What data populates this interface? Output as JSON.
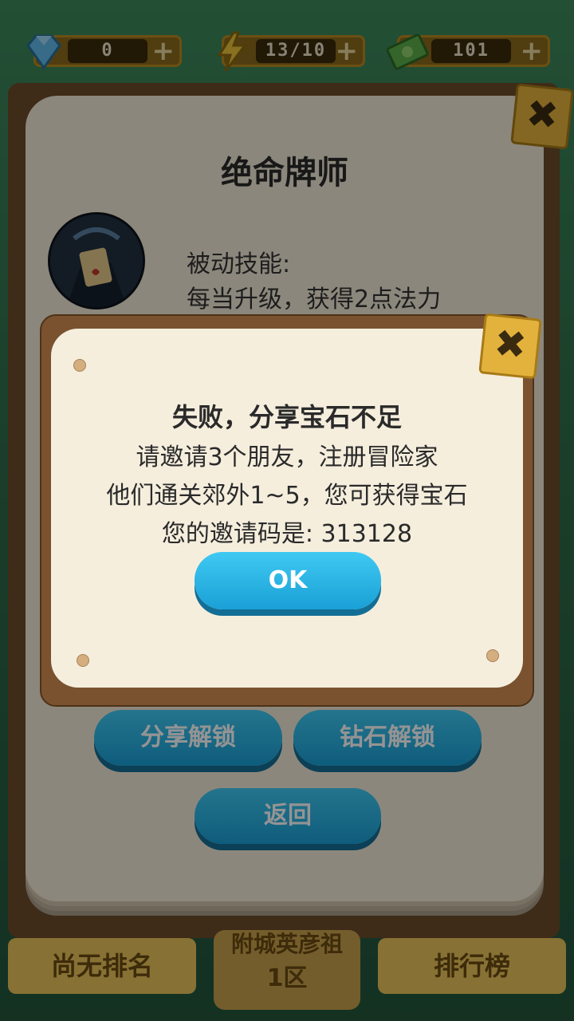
{
  "resources": {
    "gems": "0",
    "energy": "13/10",
    "cash": "101",
    "plus": "+"
  },
  "hero_card": {
    "title": "绝命牌师",
    "skill_label": "被动技能:",
    "skill_desc": "每当升级，获得2点法力",
    "buttons": {
      "share_unlock": "分享解锁",
      "gem_unlock": "钻石解锁",
      "back": "返回"
    }
  },
  "popup": {
    "heading": "失败，分享宝石不足",
    "line1": "请邀请3个朋友，注册冒险家",
    "line2": "他们通关郊外1~5，您可获得宝石",
    "line3": "您的邀请码是: 313128",
    "ok": "OK"
  },
  "close_glyph": "✖",
  "bottom_bar": {
    "rank": "尚无排名",
    "region_name": "附城英彦祖",
    "region_zone": "1区",
    "leaderboard": "排行榜"
  },
  "colors": {
    "button_blue": "#2bb4e6",
    "close_yellow": "#e3b23c",
    "paper": "#f2e9d6"
  }
}
